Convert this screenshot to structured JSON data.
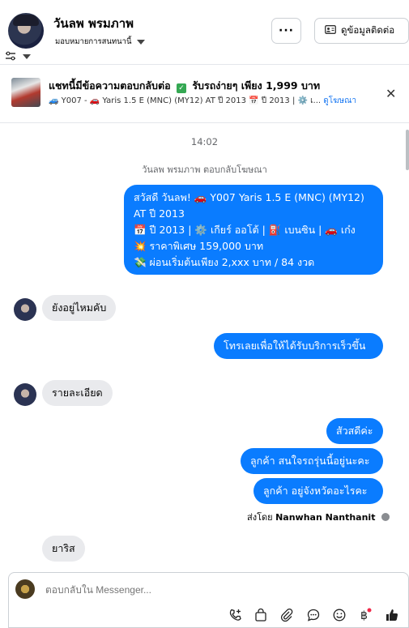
{
  "header": {
    "contact_name": "วันลพ พรมภาพ",
    "assign_label": "มอบหมายการสนทนานี้",
    "more_label": "···",
    "contact_button_label": "ดูข้อมูลติดต่อ"
  },
  "ad_banner": {
    "title_part1": "แชทนี้มีข้อความตอบกลับต่อ",
    "title_part2": "รับรถง่ายๆ เพียง 1,999 บาท",
    "subtitle": "🚙 Y007 - 🚗 Yaris 1.5 E (MNC) (MY12) AT ปี 2013 📅 ปี 2013 | ⚙️ เ...",
    "link_label": "ดูโฆษณา"
  },
  "chat": {
    "timestamp": "14:02",
    "reply_note": "วันลพ พรมภาพ ตอบกลับโฆษณา",
    "ad_message_lines": [
      "สวัสดี วันลพ! 🚗 Y007 Yaris 1.5 E (MNC) (MY12)",
      "AT ปี 2013",
      "📅 ปี 2013 | ⚙️ เกียร์ ออโต้ | ⛽ เบนซิน | 🚗 เก๋ง",
      "💥 ราคาพิเศษ 159,000 บาท",
      "💸 ผ่อนเริ่มต้นเพียง 2,xxx บาท / 84 งวด"
    ],
    "msg_customer_1": "ยังอยู่ไหมคับ",
    "msg_page_1": "โทรเลยเพื่อให้ได้รับบริการเร็วขึ้น",
    "msg_customer_2": "รายละเอียด",
    "msg_page_2": "สัวสดีค่ะ",
    "msg_page_3": "ลูกค้า สนใจรถรุ่นนี้อยู่นะคะ",
    "msg_page_4": "ลูกค้า อยู่จังหวัดอะไรคะ",
    "sent_by_prefix": "ส่งโดย",
    "sent_by_name": "Nanwhan Nanthanit",
    "msg_customer_3": "ยาริส"
  },
  "composer": {
    "placeholder": "ตอบกลับใน Messenger...",
    "tools": [
      "phone-plus-icon",
      "shopping-bag-icon",
      "paperclip-icon",
      "chat-bubble-icon",
      "smiley-icon",
      "baht-icon",
      "thumbs-up-icon"
    ]
  },
  "colors": {
    "accent": "#0a7cff",
    "bubble_grey": "#e9eaed",
    "text_secondary": "#65676b"
  }
}
